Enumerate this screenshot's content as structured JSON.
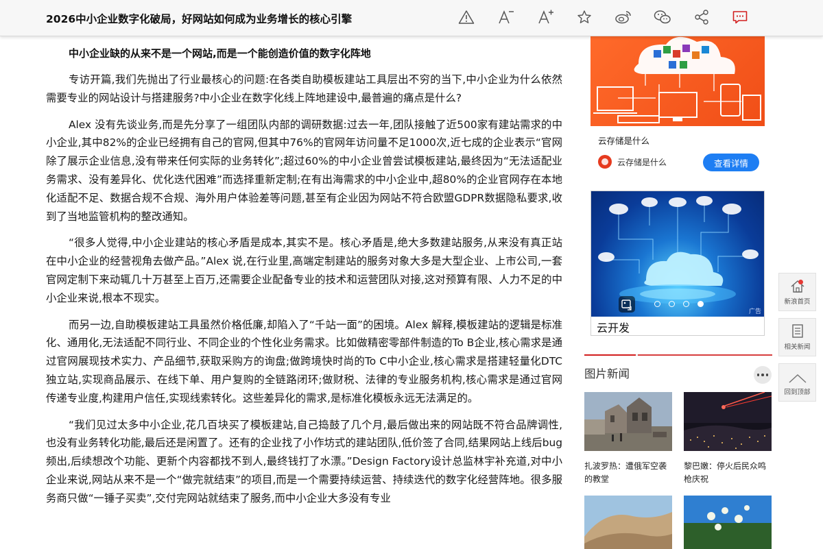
{
  "header": {
    "title": "2026中小企业数字化破局，好网站如何成为业务增长的核心引擎",
    "tools": [
      "warning-icon",
      "font-decrease-icon",
      "font-increase-icon",
      "star-icon",
      "weibo-icon",
      "wechat-icon",
      "share-icon",
      "comment-icon"
    ],
    "accent": "#d21e1e"
  },
  "article": {
    "heading": "中小企业缺的从来不是一个网站,而是一个能创造价值的数字化阵地",
    "paragraphs": [
      "专访开篇,我们先抛出了行业最核心的问题:在各类自助模板建站工具层出不穷的当下,中小企业为什么依然需要专业的网站设计与搭建服务?中小企业在数字化线上阵地建设中,最普遍的痛点是什么?",
      "Alex 没有先谈业务,而是先分享了一组团队内部的调研数据:过去一年,团队接触了近500家有建站需求的中小企业,其中82%的企业已经拥有自己的官网,但其中76%的官网年访问量不足1000次,近七成的企业表示“官网除了展示企业信息,没有带来任何实际的业务转化”;超过60%的中小企业曾尝试模板建站,最终因为“无法适配业务需求、没有差异化、优化迭代困难”而选择重新定制;在有出海需求的中小企业中,超80%的企业官网存在本地化适配不足、数据合规不合规、海外用户体验差等问题,甚至有企业因为网站不符合欧盟GDPR数据隐私要求,收到了当地监管机构的整改通知。",
      "“很多人觉得,中小企业建站的核心矛盾是成本,其实不是。核心矛盾是,绝大多数建站服务,从来没有真正站在中小企业的经营视角去做产品。”Alex 说,在行业里,高端定制建站的服务对象大多是大型企业、上市公司,一套官网定制下来动辄几十万甚至上百万,还需要企业配备专业的技术和运营团队对接,这对预算有限、人力不足的中小企业来说,根本不现实。",
      "而另一边,自助模板建站工具虽然价格低廉,却陷入了“千站一面”的困境。Alex 解释,模板建站的逻辑是标准化、通用化,无法适配不同行业、不同企业的个性化业务需求。比如做精密零部件制造的To B企业,核心需求是通过官网展现技术实力、产品细节,获取采购方的询盘;做跨境快时尚的To C中小企业,核心需求是搭建轻量化DTC独立站,实现商品展示、在线下单、用户复购的全链路闭环;做财税、法律的专业服务机构,核心需求是通过官网传递专业度,构建用户信任,实现线索转化。这些差异化的需求,是标准化模板永远无法满足的。",
      "“我们见过太多中小企业,花几百块买了模板建站,自己捣鼓了几个月,最后做出来的网站既不符合品牌调性,也没有业务转化功能,最后还是闲置了。还有的企业找了小作坊式的建站团队,低价签了合同,结果网站上线后bug频出,后续想改个功能、更新个内容都找不到人,最终钱打了水漂。”Design Factory设计总监林宇补充道,对中小企业来说,网站从来不是一个“做完就结束”的项目,而是一个需要持续运营、持续迭代的数字化经营阵地。很多服务商只做“一锤子买卖”,交付完网站就结束了服务,而中小企业大多没有专业"
    ]
  },
  "sidebar": {
    "ad1": {
      "caption": "云存储是什么",
      "brand": "云存储是什么",
      "button": "查看详情"
    },
    "ad2": {
      "caption": "云开发",
      "badge": "广告",
      "slides": 4,
      "active_slide": 4
    },
    "section_title": "图片新闻",
    "news": [
      {
        "caption": "扎波罗热：遭俄军空袭的教堂"
      },
      {
        "caption": "黎巴嫩：停火后民众鸣枪庆祝"
      },
      {
        "caption": ""
      },
      {
        "caption": ""
      }
    ]
  },
  "sidenav": {
    "home": "新浪首页",
    "related": "相关新闻",
    "top": "回到顶部"
  }
}
